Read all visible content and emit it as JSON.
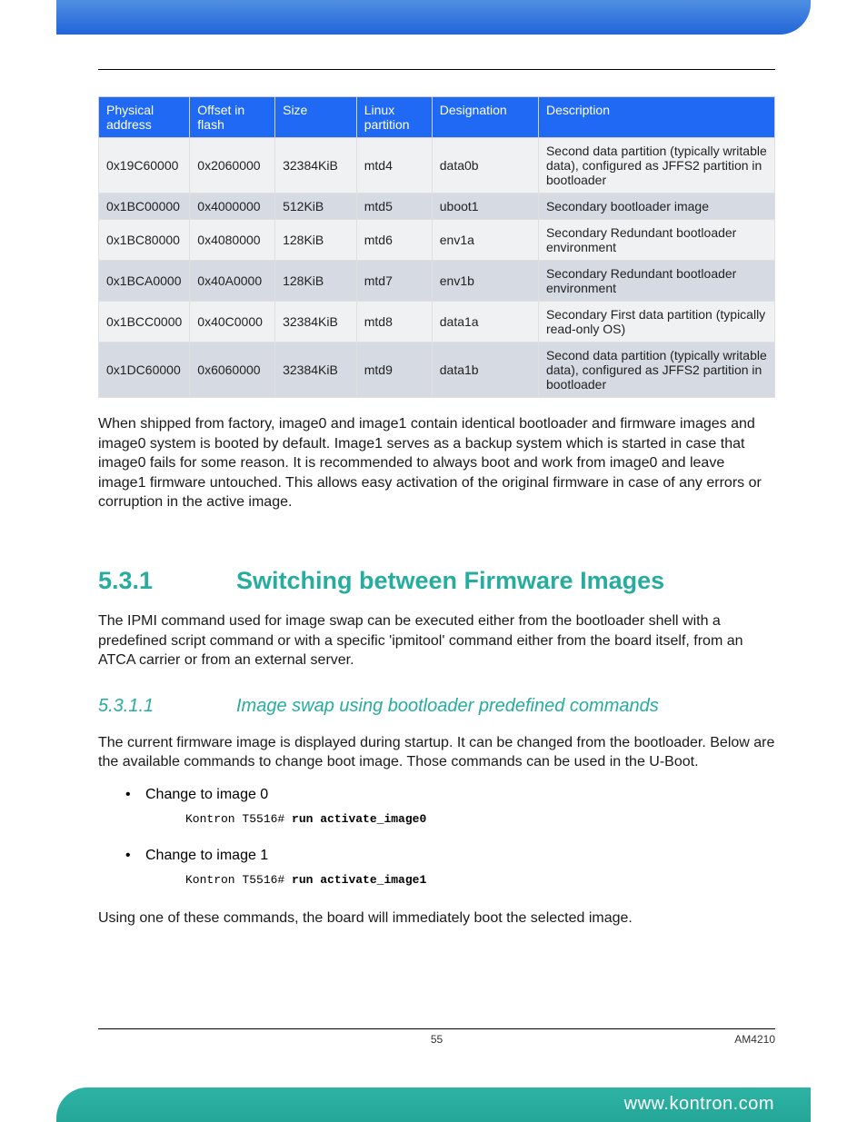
{
  "table": {
    "headers": [
      "Physical address",
      "Offset in flash",
      "Size",
      "Linux parti­tion",
      "Designation",
      "Description"
    ],
    "rows": [
      [
        "0x19C60000",
        "0x2060000",
        "32384KiB",
        "mtd4",
        "data0b",
        "Second data partition (typically writable data), configured as JFFS2 partition in bootloader"
      ],
      [
        "0x1BC00000",
        "0x4000000",
        "512KiB",
        "mtd5",
        "uboot1",
        "Secondary bootloader image"
      ],
      [
        "0x1BC80000",
        "0x4080000",
        "128KiB",
        "mtd6",
        "env1a",
        "Secondary Redundant bootloader environment"
      ],
      [
        "0x1BCA0000",
        "0x40A0000",
        "128KiB",
        "mtd7",
        "env1b",
        "Secondary Redundant bootloader environment"
      ],
      [
        "0x1BCC0000",
        "0x40C0000",
        "32384KiB",
        "mtd8",
        "data1a",
        "Secondary First data partition (typically read-only OS)"
      ],
      [
        "0x1DC60000",
        "0x6060000",
        "32384KiB",
        "mtd9",
        "data1b",
        "Second data partition (typically writable data), configured as JFFS2 partition in bootloader"
      ]
    ]
  },
  "para1": "When shipped from factory, image0 and image1 contain identical bootloader and firmware images and image0 system is booted by default. Image1 serves as a backup system which is started in case that image0 fails for some reason. It is recommended to always boot and work from image0 and leave image1 firmware untouched. This allows easy activation of the original firmware in case of any errors or corruption in the active image.",
  "h1": {
    "num": "5.3.1",
    "txt": "Switching between Firmware Images"
  },
  "para2": "The IPMI command used for image swap can be executed either from the bootloader shell with a predefined script command or with a specific 'ipmitool' command either from the board itself, from an ATCA carrier or from an external server.",
  "h2": {
    "num": "5.3.1.1",
    "txt": "Image swap using bootloader predefined commands"
  },
  "para3": "The current firmware image is displayed during startup. It can be changed from the bootloader. Below are the available commands to change boot image. Those commands can be used in the U-Boot.",
  "bullets": [
    {
      "label": "Change to image 0",
      "prompt": "Kontron T5516# ",
      "cmd": "run activate_image0"
    },
    {
      "label": "Change to image 1",
      "prompt": "Kontron T5516# ",
      "cmd": "run activate_image1"
    }
  ],
  "para4": "Using one of these commands, the board will  immediately boot the selected image.",
  "footer": {
    "page": "55",
    "doc": "AM4210",
    "url": "www.kontron.com"
  }
}
